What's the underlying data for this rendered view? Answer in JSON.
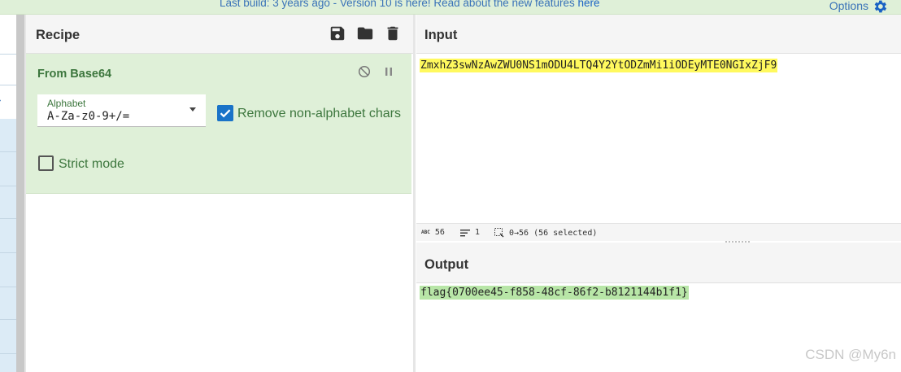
{
  "banner": {
    "text": "Last build: 3 years ago - Version 10 is here! Read about the new features ",
    "link": "here",
    "options_label": "Options"
  },
  "recipe": {
    "title": "Recipe",
    "operation": {
      "name": "From Base64",
      "alphabet_label": "Alphabet",
      "alphabet_value": "A-Za-z0-9+/=",
      "remove_non_alphabet_label": "Remove non-alphabet chars",
      "remove_non_alphabet_checked": true,
      "strict_mode_label": "Strict mode",
      "strict_mode_checked": false
    }
  },
  "input": {
    "title": "Input",
    "value": "ZmxhZ3swNzAwZWU0NS1mODU4LTQ4Y2YtODZmMi1iODEyMTE0NGIxZjF9"
  },
  "status": {
    "length": "56",
    "lines": "1",
    "selection": "0→56 (56 selected)"
  },
  "output": {
    "title": "Output",
    "value": "flag{0700ee45-f858-48cf-86f2-b8121144b1f1}"
  },
  "watermark": "CSDN @My6n",
  "colors": {
    "input_highlight": "#fff95e",
    "output_highlight": "#b8e6a7",
    "operation_bg": "#dff0d8",
    "accent_blue": "#1a73c8"
  }
}
